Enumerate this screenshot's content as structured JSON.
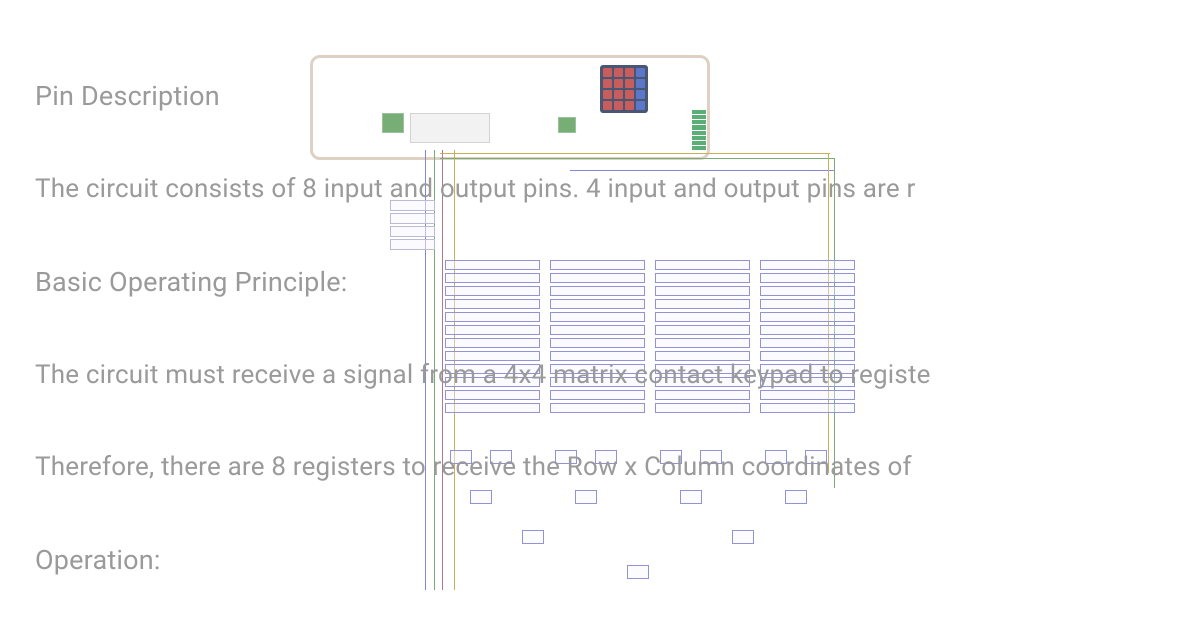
{
  "text": {
    "heading1": "Pin Description",
    "para1": "The circuit consists of 8 input and output pins. 4 input and output pins are r",
    "heading2": "Basic Operating Principle:",
    "para2": "The circuit must receive a signal from a 4x4 matrix contact keypad to registe",
    "para3": "Therefore, there are 8 registers to receive the Row x Column coordinates of",
    "heading3": "Operation:"
  },
  "diagram": {
    "keypad_rows": 4,
    "keypad_cols": 4,
    "led_count": 8,
    "register_columns": 4,
    "registers_per_column": 12
  }
}
